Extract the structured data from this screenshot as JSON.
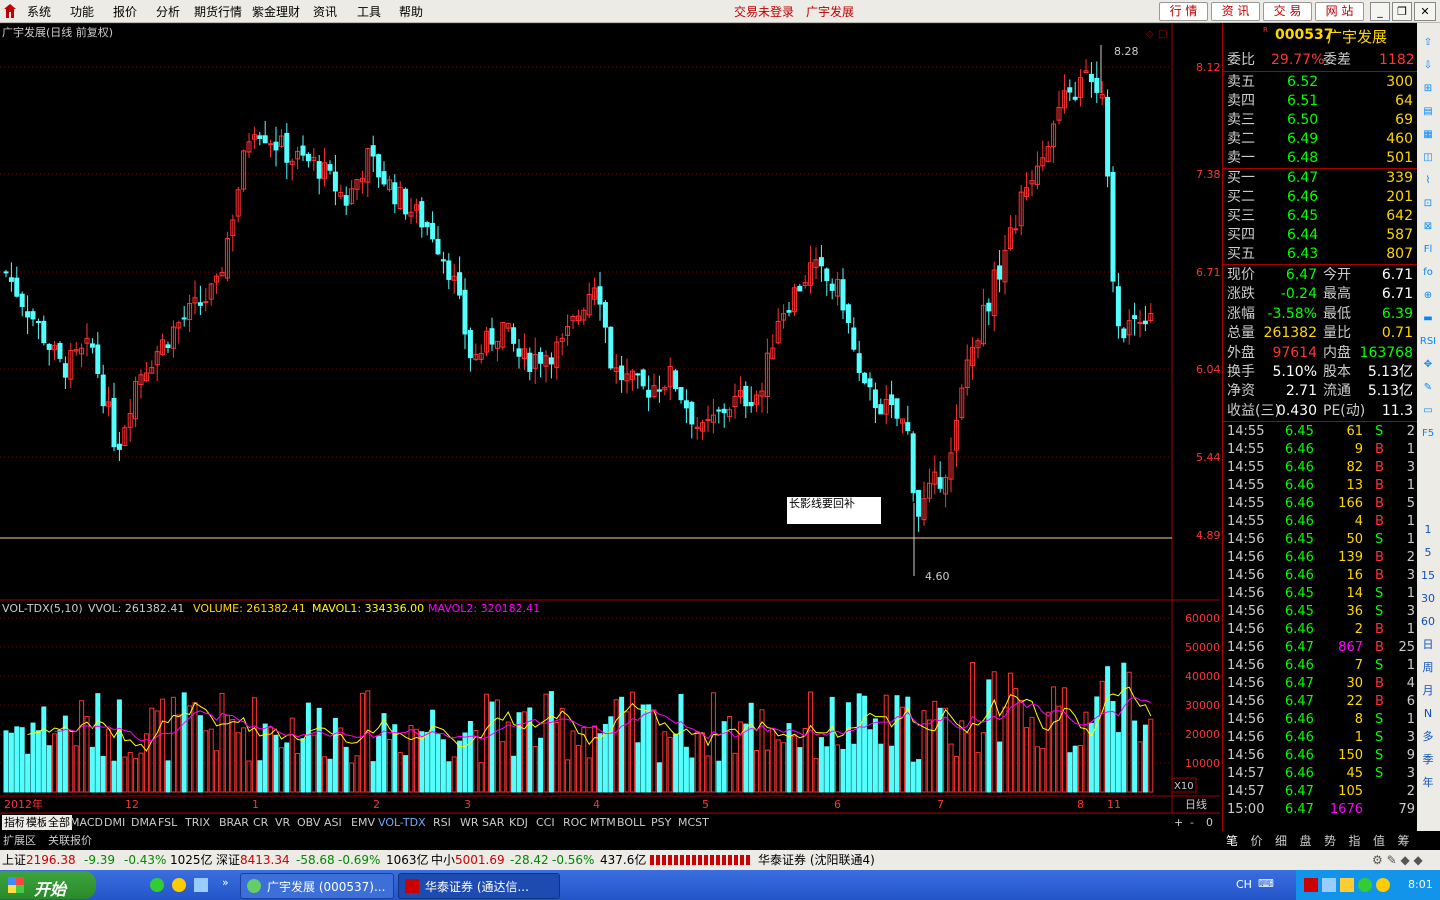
{
  "menubar": {
    "items": [
      "系统",
      "功能",
      "报价",
      "分析",
      "期货行情",
      "紫金理财",
      "资讯",
      "工具",
      "帮助"
    ],
    "center_status": "交易未登录",
    "center_stock": "广宇发展",
    "right_buttons": [
      "行 情",
      "资 讯",
      "交 易",
      "网 站"
    ]
  },
  "chart": {
    "title": "广宇发展(日线 前复权)",
    "price_labels": [
      "8.12",
      "7.38",
      "6.71",
      "6.04",
      "5.44",
      "4.89"
    ],
    "high_marker": "8.28",
    "low_marker": "4.60",
    "annotation": "长影线要回补",
    "volume_title": "VOL-TDX(5,10)",
    "volume_vvol": "VVOL: 261382.41",
    "volume_line": "VOLUME: 261382.41",
    "mavol1": "MAVOL1: 334336.00",
    "mavol2": "MAVOL2: 320182.41",
    "volume_labels": [
      "60000",
      "50000",
      "40000",
      "30000",
      "20000",
      "10000"
    ],
    "volume_unit": "X10",
    "period": "日线",
    "time_labels": [
      "2012年",
      "12",
      "1",
      "2",
      "3",
      "4",
      "5",
      "6",
      "7",
      "8",
      "11"
    ],
    "colors": {
      "up": "#ff3232",
      "down": "#54ffff",
      "ma1": "#ffff00",
      "ma2": "#ff00ff",
      "grid": "#800000",
      "axis": "#a00000"
    }
  },
  "tabs": {
    "items": [
      "指标",
      "模板",
      "全部",
      "MACD",
      "DMI",
      "DMA",
      "FSL",
      "TRIX",
      "BRAR",
      "CR",
      "VR",
      "OBV",
      "ASI",
      "EMV",
      "VOL-TDX",
      "RSI",
      "WR",
      "SAR",
      "KDJ",
      "CCI",
      "ROC",
      "MTM",
      "BOLL",
      "PSY",
      "MCST"
    ],
    "active": "VOL-TDX",
    "ext": [
      "扩展区",
      "关联报价"
    ],
    "controls": [
      "+",
      "-",
      "0"
    ]
  },
  "quote": {
    "code": "000537",
    "name": "广宇发展",
    "weibi_label": "委比",
    "weibi": "29.77%",
    "weicha_label": "委差",
    "weicha": "1182",
    "sells": [
      {
        "label": "卖五",
        "price": "6.52",
        "vol": "300"
      },
      {
        "label": "卖四",
        "price": "6.51",
        "vol": "64"
      },
      {
        "label": "卖三",
        "price": "6.50",
        "vol": "69"
      },
      {
        "label": "卖二",
        "price": "6.49",
        "vol": "460"
      },
      {
        "label": "卖一",
        "price": "6.48",
        "vol": "501"
      }
    ],
    "buys": [
      {
        "label": "买一",
        "price": "6.47",
        "vol": "339"
      },
      {
        "label": "买二",
        "price": "6.46",
        "vol": "201"
      },
      {
        "label": "买三",
        "price": "6.45",
        "vol": "642"
      },
      {
        "label": "买四",
        "price": "6.44",
        "vol": "587"
      },
      {
        "label": "买五",
        "price": "6.43",
        "vol": "807"
      }
    ],
    "stats": [
      {
        "l1": "现价",
        "v1": "6.47",
        "c1": "#0f0",
        "l2": "今开",
        "v2": "6.71",
        "c2": "#fff"
      },
      {
        "l1": "涨跌",
        "v1": "-0.24",
        "c1": "#0f0",
        "l2": "最高",
        "v2": "6.71",
        "c2": "#fff"
      },
      {
        "l1": "涨幅",
        "v1": "-3.58%",
        "c1": "#0f0",
        "l2": "最低",
        "v2": "6.39",
        "c2": "#0f0"
      },
      {
        "l1": "总量",
        "v1": "261382",
        "c1": "#ffd700",
        "l2": "量比",
        "v2": "0.71",
        "c2": "#ffd700"
      },
      {
        "l1": "外盘",
        "v1": "97614",
        "c1": "#f33",
        "l2": "内盘",
        "v2": "163768",
        "c2": "#0f0"
      },
      {
        "l1": "换手",
        "v1": "5.10%",
        "c1": "#fff",
        "l2": "股本",
        "v2": "5.13亿",
        "c2": "#fff"
      },
      {
        "l1": "净资",
        "v1": "2.71",
        "c1": "#fff",
        "l2": "流通",
        "v2": "5.13亿",
        "c2": "#fff"
      },
      {
        "l1": "收益(三)",
        "v1": "0.430",
        "c1": "#fff",
        "l2": "PE(动)",
        "v2": "11.3",
        "c2": "#fff"
      }
    ],
    "ticks": [
      {
        "t": "14:55",
        "p": "6.45",
        "v": "61",
        "s": "S",
        "n": "2"
      },
      {
        "t": "14:55",
        "p": "6.46",
        "v": "9",
        "s": "B",
        "n": "1"
      },
      {
        "t": "14:55",
        "p": "6.46",
        "v": "82",
        "s": "B",
        "n": "3"
      },
      {
        "t": "14:55",
        "p": "6.46",
        "v": "13",
        "s": "B",
        "n": "1"
      },
      {
        "t": "14:55",
        "p": "6.46",
        "v": "166",
        "s": "B",
        "n": "5"
      },
      {
        "t": "14:55",
        "p": "6.46",
        "v": "4",
        "s": "B",
        "n": "1"
      },
      {
        "t": "14:56",
        "p": "6.45",
        "v": "50",
        "s": "S",
        "n": "1"
      },
      {
        "t": "14:56",
        "p": "6.46",
        "v": "139",
        "s": "B",
        "n": "2"
      },
      {
        "t": "14:56",
        "p": "6.46",
        "v": "16",
        "s": "B",
        "n": "3"
      },
      {
        "t": "14:56",
        "p": "6.45",
        "v": "14",
        "s": "S",
        "n": "1"
      },
      {
        "t": "14:56",
        "p": "6.45",
        "v": "36",
        "s": "S",
        "n": "3"
      },
      {
        "t": "14:56",
        "p": "6.46",
        "v": "2",
        "s": "B",
        "n": "1"
      },
      {
        "t": "14:56",
        "p": "6.47",
        "v": "867",
        "s": "B",
        "n": "25"
      },
      {
        "t": "14:56",
        "p": "6.46",
        "v": "7",
        "s": "S",
        "n": "1"
      },
      {
        "t": "14:56",
        "p": "6.47",
        "v": "30",
        "s": "B",
        "n": "4"
      },
      {
        "t": "14:56",
        "p": "6.47",
        "v": "22",
        "s": "B",
        "n": "6"
      },
      {
        "t": "14:56",
        "p": "6.46",
        "v": "8",
        "s": "S",
        "n": "1"
      },
      {
        "t": "14:56",
        "p": "6.46",
        "v": "1",
        "s": "S",
        "n": "3"
      },
      {
        "t": "14:56",
        "p": "6.46",
        "v": "150",
        "s": "S",
        "n": "9"
      },
      {
        "t": "14:57",
        "p": "6.46",
        "v": "45",
        "s": "S",
        "n": "3"
      },
      {
        "t": "14:57",
        "p": "6.47",
        "v": "105",
        "s": "",
        "n": "2"
      },
      {
        "t": "15:00",
        "p": "6.47",
        "v": "1676",
        "s": "",
        "n": "79"
      }
    ],
    "bottom_tabs": [
      "笔",
      "价",
      "细",
      "盘",
      "势",
      "指",
      "值",
      "筹"
    ]
  },
  "right_tools": [
    "1",
    "5",
    "15",
    "30",
    "60",
    "日",
    "周",
    "月",
    "N",
    "多",
    "季",
    "年"
  ],
  "status": {
    "sh_label": "上证",
    "sh": "2196.38",
    "sh_chg": "-9.39",
    "sh_pct": "-0.43%",
    "sh_amt": "1025亿",
    "sz_label": "深证",
    "sz": "8413.34",
    "sz_chg": "-58.68",
    "sz_pct": "-0.69%",
    "sz_amt": "1063亿",
    "zx_label": "中小",
    "zx": "5001.69",
    "zx_chg": "-28.42",
    "zx_pct": "-0.56%",
    "zx_amt": "437.6亿",
    "broker": "华泰证券 (沈阳联通4)"
  },
  "taskbar": {
    "start": "开始",
    "task1": "广宇发展 (000537)...",
    "task2": "华泰证券 (通达信...",
    "lang": "CH",
    "time": "8:01"
  }
}
